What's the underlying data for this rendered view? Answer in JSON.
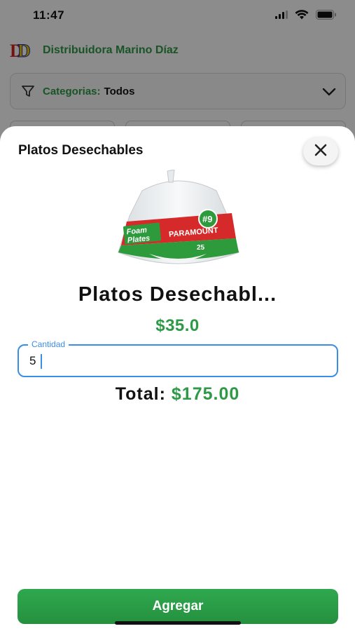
{
  "status_bar": {
    "time": "11:47"
  },
  "app": {
    "brand_name": "Distribuidora Marino Díaz",
    "category_filter": {
      "label": "Categorias:",
      "value": "Todos"
    }
  },
  "modal": {
    "title": "Platos Desechables",
    "product": {
      "name_display": "Platos Desechabl...",
      "price": "$35.0",
      "image_label": "Foam Plates",
      "image_size_text": "#9",
      "image_count_text": "25",
      "image_brand_text": "PARAMOUNT"
    },
    "quantity": {
      "label": "Cantidad",
      "value": "5"
    },
    "total": {
      "label": "Total:",
      "value": "$175.00"
    },
    "add_button_label": "Agregar"
  },
  "colors": {
    "accent_green": "#2e9a47",
    "focus_blue": "#3a8ee6",
    "overlay": "rgba(0,0,0,0.45)"
  },
  "icons": [
    "wifi-icon",
    "battery-icon",
    "signal-icon",
    "filter-icon",
    "chevron-down-icon",
    "close-icon"
  ]
}
